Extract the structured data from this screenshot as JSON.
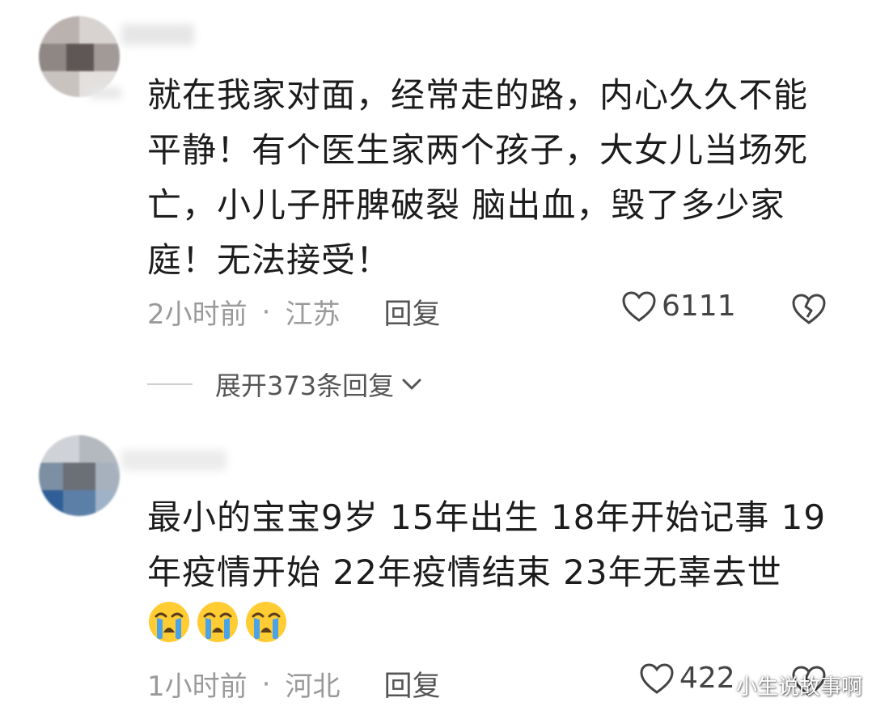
{
  "comments": [
    {
      "text": "就在我家对面，经常走的路，内心久久不能平静！有个医生家两个孩子，大女儿当场死亡，小儿子肝脾破裂 脑出血，毁了多少家庭！无法接受！",
      "time": "2小时前",
      "location": "江苏",
      "reply_label": "回复",
      "likes": "6111",
      "expand_label": "展开373条回复"
    },
    {
      "text": "最小的宝宝9岁 15年出生 18年开始记事 19年疫情开始 22年疫情结束 23年无辜去世",
      "emojis": [
        "crying-emoji",
        "crying-emoji",
        "crying-emoji"
      ],
      "time": "1小时前",
      "location": "河北",
      "reply_label": "回复",
      "likes": "422"
    }
  ],
  "separator_dot": "·",
  "watermark": "小生说故事啊",
  "colors": {
    "text": "#1c1c1c",
    "meta": "#9a9a9a",
    "icon": "#444444",
    "emoji_face": "#ffcc33",
    "emoji_tears": "#4aa3e8"
  }
}
